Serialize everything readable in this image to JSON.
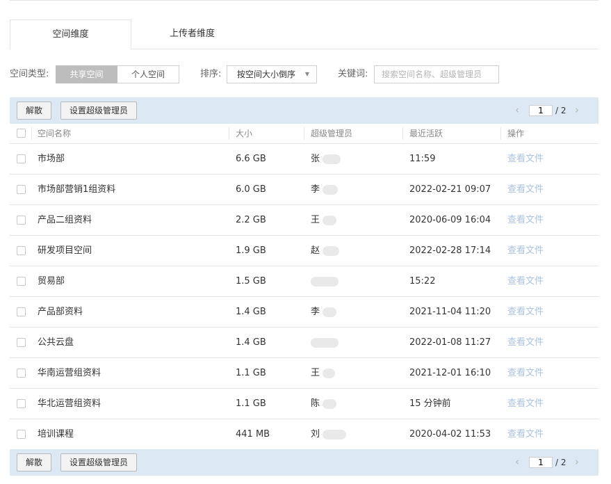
{
  "tabs": [
    {
      "label": "空间维度"
    },
    {
      "label": "上传者维度"
    }
  ],
  "filter": {
    "type_label": "空间类型:",
    "type_options": [
      "共享空间",
      "个人空间"
    ],
    "sort_label": "排序:",
    "sort_value": "按空间大小倒序",
    "keyword_label": "关键词:",
    "keyword_placeholder": "搜索空间名称、超级管理员"
  },
  "actions": {
    "unlock": "解散",
    "set_admin": "设置超级管理员"
  },
  "pager": {
    "current": "1",
    "total_text": "/ 2"
  },
  "table": {
    "headers": [
      "空间名称",
      "大小",
      "超级管理员",
      "最近活跃",
      "操作"
    ],
    "rows": [
      {
        "name": "市场部",
        "size": "6.6 GB",
        "admin": "张",
        "active": "11:59",
        "op": "查看文件"
      },
      {
        "name": "市场部营销1组资料",
        "size": "6.0 GB",
        "admin": "李",
        "active": "2022-02-21 09:07",
        "op": "查看文件"
      },
      {
        "name": "产品二组资料",
        "size": "2.2 GB",
        "admin": "王",
        "active": "2020-06-09 16:04",
        "op": "查看文件"
      },
      {
        "name": "研发项目空间",
        "size": "1.9 GB",
        "admin": "赵",
        "active": "2022-02-28 17:14",
        "op": "查看文件"
      },
      {
        "name": "贸易部",
        "size": "1.5 GB",
        "admin": "",
        "active": "15:22",
        "op": "查看文件"
      },
      {
        "name": "产品部资料",
        "size": "1.4 GB",
        "admin": "李",
        "active": "2021-11-04 11:20",
        "op": "查看文件"
      },
      {
        "name": "公共云盘",
        "size": "1.4 GB",
        "admin": "",
        "active": "2022-01-08 11:27",
        "op": "查看文件"
      },
      {
        "name": "华南运营组资料",
        "size": "1.1 GB",
        "admin": "王",
        "active": "2021-12-01 16:10",
        "op": "查看文件"
      },
      {
        "name": "华北运营组资料",
        "size": "1.1 GB",
        "admin": "陈",
        "active": "15 分钟前",
        "op": "查看文件"
      },
      {
        "name": "培训课程",
        "size": "441 MB",
        "admin": "刘",
        "active": "2020-04-02 11:53",
        "op": "查看文件"
      }
    ]
  }
}
